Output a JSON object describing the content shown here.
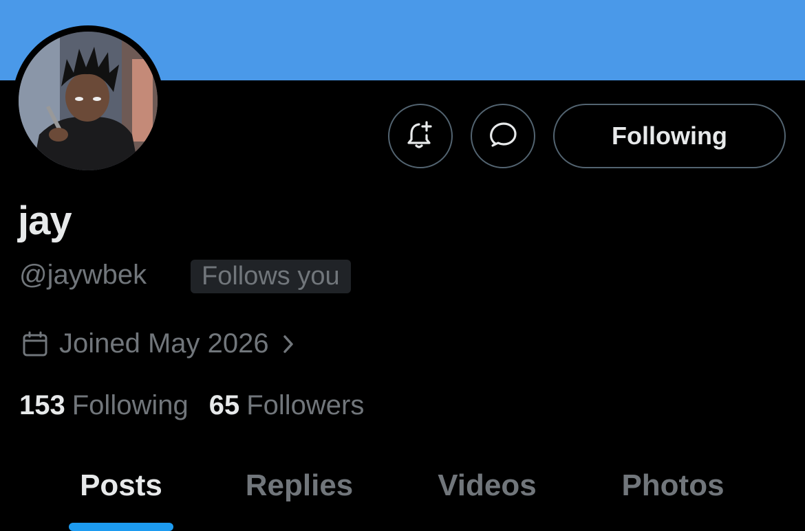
{
  "profile": {
    "display_name": "jay",
    "handle": "@jaywbek",
    "follows_you_badge": "Follows you",
    "joined": "Joined May 2026",
    "following_count": "153",
    "following_label": "Following",
    "followers_count": "65",
    "followers_label": "Followers"
  },
  "actions": {
    "notify_icon": "bell-plus-icon",
    "message_icon": "chat-bubble-icon",
    "follow_button_label": "Following"
  },
  "tabs": [
    {
      "label": "Posts",
      "active": true
    },
    {
      "label": "Replies",
      "active": false
    },
    {
      "label": "Videos",
      "active": false
    },
    {
      "label": "Photos",
      "active": false
    }
  ],
  "colors": {
    "banner": "#4a99e9",
    "background": "#000000",
    "primary_text": "#e7e9ea",
    "secondary_text": "#71767b",
    "accent": "#1d9bf0"
  }
}
